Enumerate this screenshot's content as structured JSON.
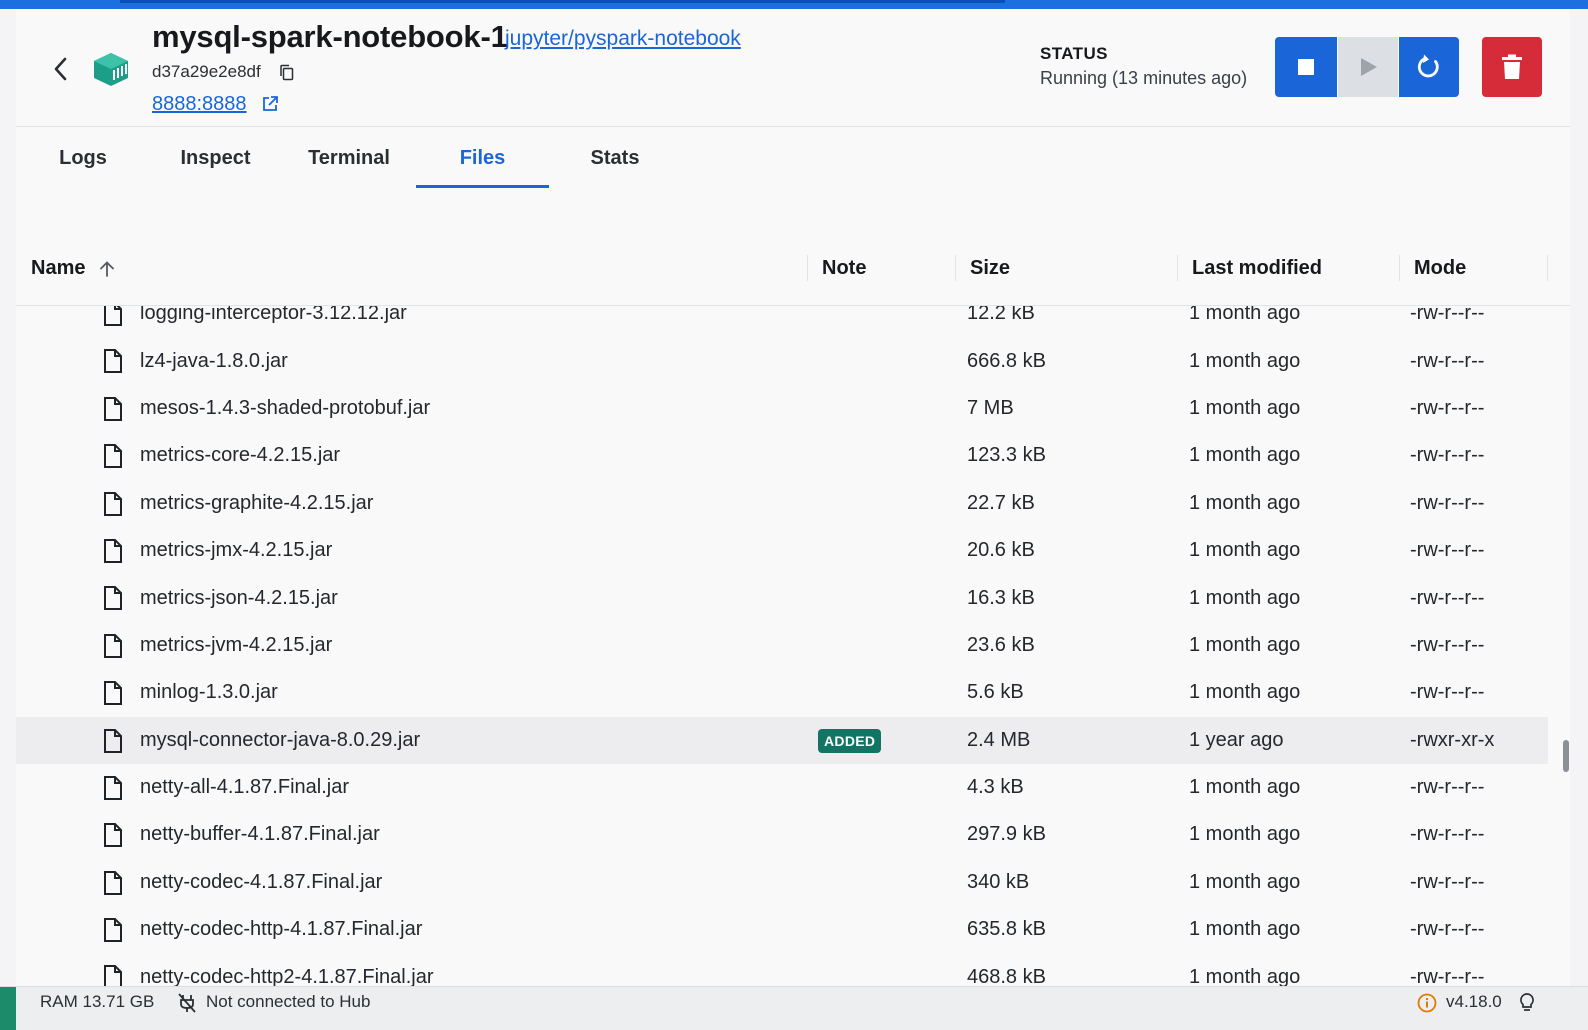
{
  "header": {
    "title": "mysql-spark-notebook-1",
    "image_link": "jupyter/pyspark-notebook",
    "container_id": "d37a29e2e8df",
    "port_link": "8888:8888",
    "status_label": "STATUS",
    "status_text": "Running (13 minutes ago)"
  },
  "tabs": [
    {
      "label": "Logs"
    },
    {
      "label": "Inspect"
    },
    {
      "label": "Terminal"
    },
    {
      "label": "Files",
      "active": true
    },
    {
      "label": "Stats"
    }
  ],
  "table": {
    "columns": {
      "name": "Name",
      "note": "Note",
      "size": "Size",
      "modified": "Last modified",
      "mode": "Mode"
    },
    "rows": [
      {
        "name": "logging-interceptor-3.12.12.jar",
        "note": "",
        "size": "12.2 kB",
        "modified": "1 month ago",
        "mode": "-rw-r--r--"
      },
      {
        "name": "lz4-java-1.8.0.jar",
        "note": "",
        "size": "666.8 kB",
        "modified": "1 month ago",
        "mode": "-rw-r--r--"
      },
      {
        "name": "mesos-1.4.3-shaded-protobuf.jar",
        "note": "",
        "size": "7 MB",
        "modified": "1 month ago",
        "mode": "-rw-r--r--"
      },
      {
        "name": "metrics-core-4.2.15.jar",
        "note": "",
        "size": "123.3 kB",
        "modified": "1 month ago",
        "mode": "-rw-r--r--"
      },
      {
        "name": "metrics-graphite-4.2.15.jar",
        "note": "",
        "size": "22.7 kB",
        "modified": "1 month ago",
        "mode": "-rw-r--r--"
      },
      {
        "name": "metrics-jmx-4.2.15.jar",
        "note": "",
        "size": "20.6 kB",
        "modified": "1 month ago",
        "mode": "-rw-r--r--"
      },
      {
        "name": "metrics-json-4.2.15.jar",
        "note": "",
        "size": "16.3 kB",
        "modified": "1 month ago",
        "mode": "-rw-r--r--"
      },
      {
        "name": "metrics-jvm-4.2.15.jar",
        "note": "",
        "size": "23.6 kB",
        "modified": "1 month ago",
        "mode": "-rw-r--r--"
      },
      {
        "name": "minlog-1.3.0.jar",
        "note": "",
        "size": "5.6 kB",
        "modified": "1 month ago",
        "mode": "-rw-r--r--"
      },
      {
        "name": "mysql-connector-java-8.0.29.jar",
        "note": "ADDED",
        "size": "2.4 MB",
        "modified": "1 year ago",
        "mode": "-rwxr-xr-x",
        "highlight": true
      },
      {
        "name": "netty-all-4.1.87.Final.jar",
        "note": "",
        "size": "4.3 kB",
        "modified": "1 month ago",
        "mode": "-rw-r--r--"
      },
      {
        "name": "netty-buffer-4.1.87.Final.jar",
        "note": "",
        "size": "297.9 kB",
        "modified": "1 month ago",
        "mode": "-rw-r--r--"
      },
      {
        "name": "netty-codec-4.1.87.Final.jar",
        "note": "",
        "size": "340 kB",
        "modified": "1 month ago",
        "mode": "-rw-r--r--"
      },
      {
        "name": "netty-codec-http-4.1.87.Final.jar",
        "note": "",
        "size": "635.8 kB",
        "modified": "1 month ago",
        "mode": "-rw-r--r--"
      },
      {
        "name": "netty-codec-http2-4.1.87.Final.jar",
        "note": "",
        "size": "468.8 kB",
        "modified": "1 month ago",
        "mode": "-rw-r--r--"
      }
    ]
  },
  "statusbar": {
    "ram": "RAM 13.71 GB",
    "hub": "Not connected to Hub",
    "version": "v4.18.0"
  },
  "colors": {
    "accent": "#1a66d9",
    "danger": "#d62b39",
    "badge": "#127563"
  }
}
